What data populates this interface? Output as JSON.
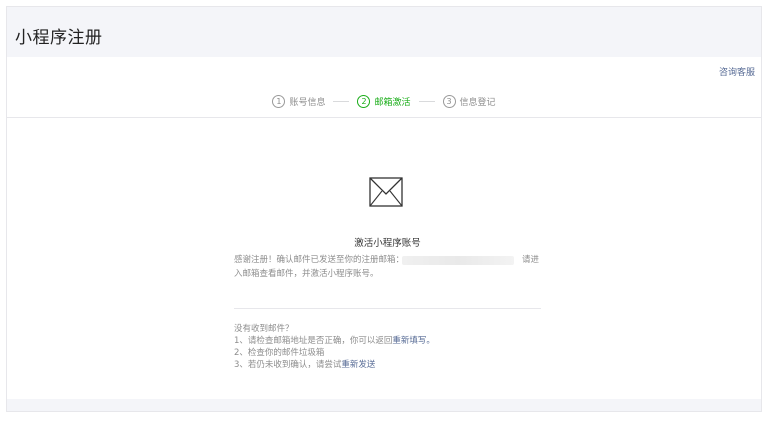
{
  "header": {
    "title": "小程序注册"
  },
  "support_link": "咨询客服",
  "steps": [
    {
      "num": "1",
      "label": "账号信息",
      "active": false
    },
    {
      "num": "2",
      "label": "邮箱激活",
      "active": true
    },
    {
      "num": "3",
      "label": "信息登记",
      "active": false
    }
  ],
  "activation": {
    "title": "激活小程序账号",
    "desc_prefix": "感谢注册！确认邮件已发送至你的注册邮箱：",
    "desc_suffix": "请进",
    "desc_line2": "入邮箱查看邮件，并激活小程序账号。"
  },
  "help": {
    "heading": "没有收到邮件？",
    "item1_text": "1、请检查邮箱地址是否正确，你可以返回",
    "item1_link": "重新填写。",
    "item2_text": "2、检查你的邮件垃圾箱",
    "item3_text": "3、若仍未收到确认，请尝试",
    "item3_link": "重新发送"
  },
  "colors": {
    "accent": "#1aad19",
    "link": "#576b95"
  }
}
